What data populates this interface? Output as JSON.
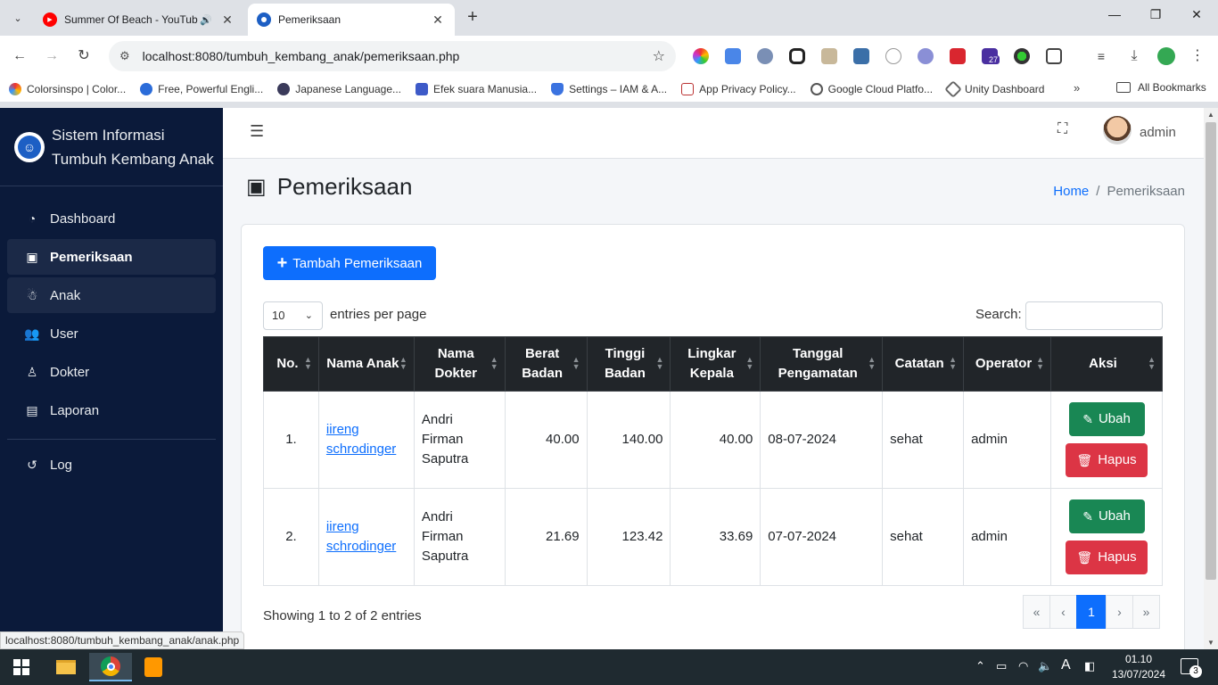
{
  "browser": {
    "tabs": [
      {
        "title": "Summer Of Beach - YouTub",
        "active": false
      },
      {
        "title": "Pemeriksaan",
        "active": true
      }
    ],
    "url": "localhost:8080/tumbuh_kembang_anak/pemeriksaan.php",
    "bookmarks": [
      {
        "label": "Colorsinspo | Color..."
      },
      {
        "label": "Free, Powerful Engli..."
      },
      {
        "label": "Japanese Language..."
      },
      {
        "label": "Efek suara Manusia..."
      },
      {
        "label": "Settings – IAM & A..."
      },
      {
        "label": "App Privacy Policy..."
      },
      {
        "label": "Google Cloud Platfo..."
      },
      {
        "label": "Unity Dashboard"
      }
    ],
    "all_bookmarks": "All Bookmarks",
    "extension_badge": "27",
    "status_url": "localhost:8080/tumbuh_kembang_anak/anak.php"
  },
  "sidebar": {
    "brand_line1": "Sistem Informasi",
    "brand_line2": "Tumbuh Kembang Anak",
    "items": [
      {
        "label": "Dashboard",
        "icon": "gauge-icon"
      },
      {
        "label": "Pemeriksaan",
        "icon": "clipboard-medical-icon"
      },
      {
        "label": "Anak",
        "icon": "child-icon"
      },
      {
        "label": "User",
        "icon": "users-icon"
      },
      {
        "label": "Dokter",
        "icon": "doctor-icon"
      },
      {
        "label": "Laporan",
        "icon": "file-icon"
      },
      {
        "label": "Log",
        "icon": "history-icon"
      }
    ]
  },
  "topnav": {
    "username": "admin"
  },
  "page": {
    "title": "Pemeriksaan",
    "breadcrumb_home": "Home",
    "breadcrumb_current": "Pemeriksaan"
  },
  "card": {
    "add_button": "Tambah Pemeriksaan",
    "page_length": "10",
    "entries_label": "entries per page",
    "search_label": "Search:",
    "columns": [
      "No.",
      "Nama Anak",
      "Nama Dokter",
      "Berat Badan",
      "Tinggi Badan",
      "Lingkar Kepala",
      "Tanggal Pengamatan",
      "Catatan",
      "Operator",
      "Aksi"
    ],
    "rows": [
      {
        "no": "1.",
        "anak": "iireng schrodinger",
        "dokter": "Andri Firman Saputra",
        "berat": "40.00",
        "tinggi": "140.00",
        "lingkar": "40.00",
        "tanggal": "08-07-2024",
        "catatan": "sehat",
        "operator": "admin"
      },
      {
        "no": "2.",
        "anak": "iireng schrodinger",
        "dokter": "Andri Firman Saputra",
        "berat": "21.69",
        "tinggi": "123.42",
        "lingkar": "33.69",
        "tanggal": "07-07-2024",
        "catatan": "sehat",
        "operator": "admin"
      }
    ],
    "edit_label": "Ubah",
    "delete_label": "Hapus",
    "info": "Showing 1 to 2 of 2 entries",
    "pager": {
      "first": "«",
      "prev": "‹",
      "current": "1",
      "next": "›",
      "last": "»"
    }
  },
  "taskbar": {
    "time": "01.10",
    "date": "13/07/2024",
    "notifications": "3"
  },
  "colors": {
    "sidebar_bg": "#0b1a3a",
    "primary": "#0d6efd",
    "success": "#198754",
    "danger": "#dc3545",
    "table_head": "#212529"
  }
}
